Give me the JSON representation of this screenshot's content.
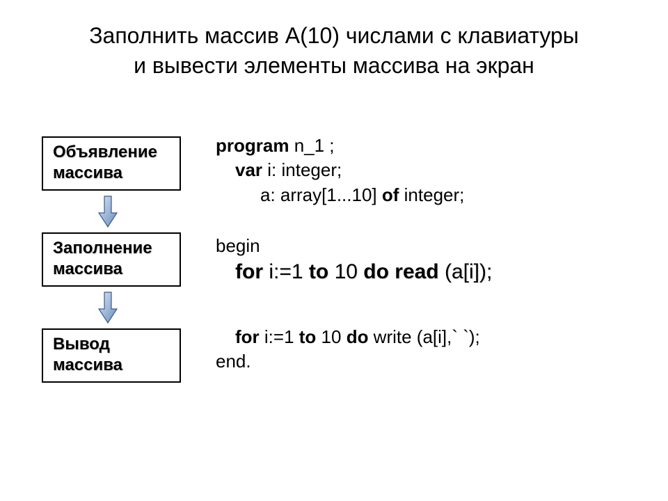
{
  "title_line1": "Заполнить массив А(10) числами с клавиатуры",
  "title_line2": "и вывести элементы массива на экран",
  "boxes": {
    "declare_l1": "Объявление",
    "declare_l2": "массива",
    "fill_l1": "Заполнение",
    "fill_l2": "массива",
    "output_l1": "Вывод",
    "output_l2": "массива"
  },
  "code": {
    "program_kw": "program",
    "program_name": "  n_1 ;",
    "var_kw": "var",
    "var_decl": " i: integer;",
    "arr_pre": "a: array[1...10] ",
    "of_kw": "of",
    "arr_post": " integer;",
    "begin": "begin",
    "for1_for": "for",
    "for1_mid1": " i:",
    "for1_eq": "=",
    "for1_mid2": "1 ",
    "for1_to": "to",
    "for1_mid3": " 10 ",
    "for1_do": "do read",
    "for1_end": " (a[i])",
    "for1_semi": ";",
    "for2_for": "for",
    "for2_mid1": " i:=1 ",
    "for2_to": "to",
    "for2_mid2": " 10 ",
    "for2_do": "do",
    "for2_end": " write (a[i],` `);",
    "end": "end",
    "end_dot": "."
  }
}
